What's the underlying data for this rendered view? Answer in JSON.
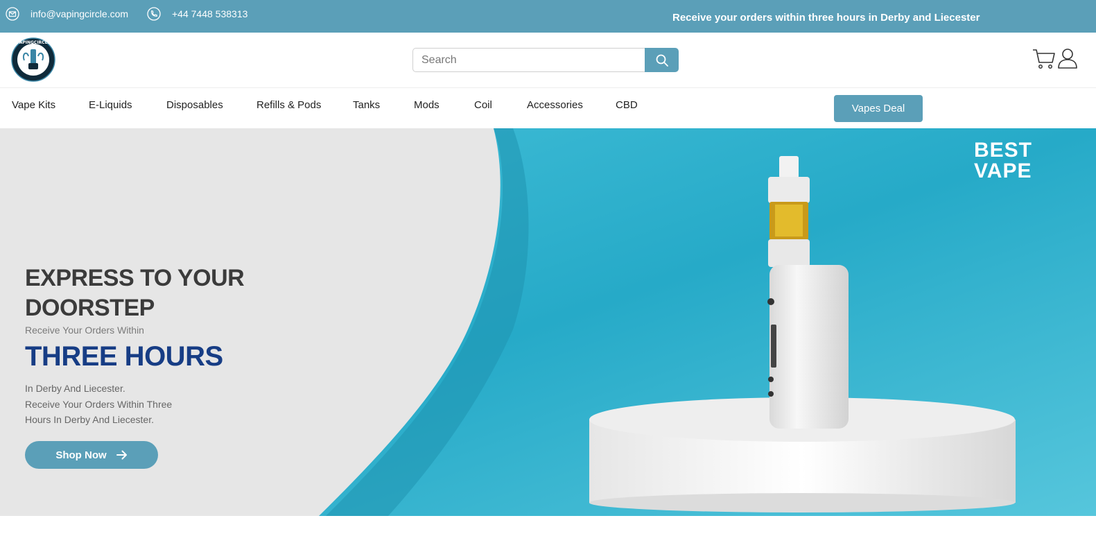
{
  "topbar": {
    "email": "info@vapingcircle.com",
    "phone": "+44 7448 538313",
    "promo": "Receive your orders within three hours in Derby and Liecester",
    "background_color": "#5b9fb8"
  },
  "header": {
    "logo_alt": "VAPINGCIRCLE",
    "search": {
      "placeholder": "Search"
    },
    "icons": [
      "search-icon",
      "cart-icon",
      "user-icon"
    ]
  },
  "nav": {
    "items": [
      {
        "label": "Vape Kits"
      },
      {
        "label": "E-Liquids"
      },
      {
        "label": "Disposables"
      },
      {
        "label": "Refills & Pods"
      },
      {
        "label": "Tanks"
      },
      {
        "label": "Mods"
      },
      {
        "label": "Coil"
      },
      {
        "label": "Accessories"
      },
      {
        "label": "CBD"
      }
    ],
    "deal_button": "Vapes Deal"
  },
  "hero": {
    "badge": [
      "BEST",
      "VAPE"
    ],
    "title_line1": "EXPRESS TO YOUR",
    "title_line2": "DOORSTEP",
    "subtitle": "Receive Your Orders Within",
    "highlight": "THREE HOURS",
    "desc_line1": "In Derby And Liecester.",
    "desc_line2": "Receive Your Orders Within Three",
    "desc_line3": "Hours In Derby And Liecester.",
    "cta": "Shop Now",
    "accent_color": "#173d85",
    "bg_color": "#3fbdd6"
  }
}
